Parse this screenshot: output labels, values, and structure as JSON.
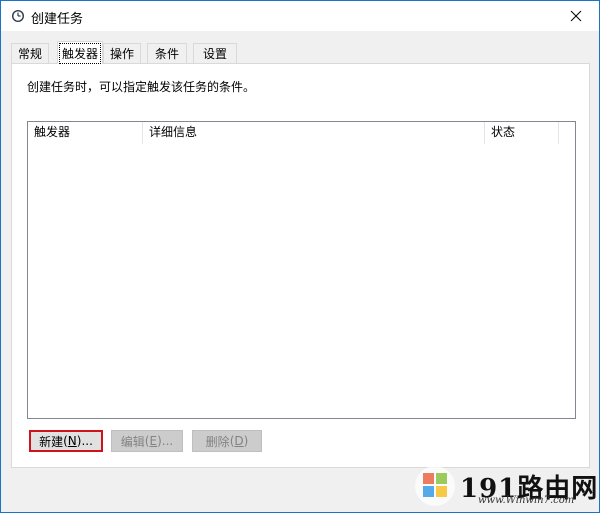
{
  "window": {
    "title": "创建任务",
    "close_glyph": "✕"
  },
  "tabs": [
    {
      "label": "常规",
      "active": false
    },
    {
      "label": "触发器",
      "active": true
    },
    {
      "label": "操作",
      "active": false
    },
    {
      "label": "条件",
      "active": false
    },
    {
      "label": "设置",
      "active": false
    }
  ],
  "triggers_panel": {
    "description": "创建任务时，可以指定触发该任务的条件。",
    "columns": [
      "触发器",
      "详细信息",
      "状态"
    ],
    "rows": []
  },
  "buttons": {
    "new": {
      "label": "新建",
      "mnemonic": "N",
      "suffix": "..."
    },
    "edit": {
      "label": "编辑",
      "mnemonic": "E",
      "suffix": "..."
    },
    "delete": {
      "label": "删除",
      "mnemonic": "D",
      "suffix": ""
    }
  },
  "watermark": {
    "brand": "191路由网",
    "url": "www.Winwin7.com"
  },
  "colors": {
    "highlight_border": "#d0121b",
    "window_border": "#1b72c8"
  }
}
